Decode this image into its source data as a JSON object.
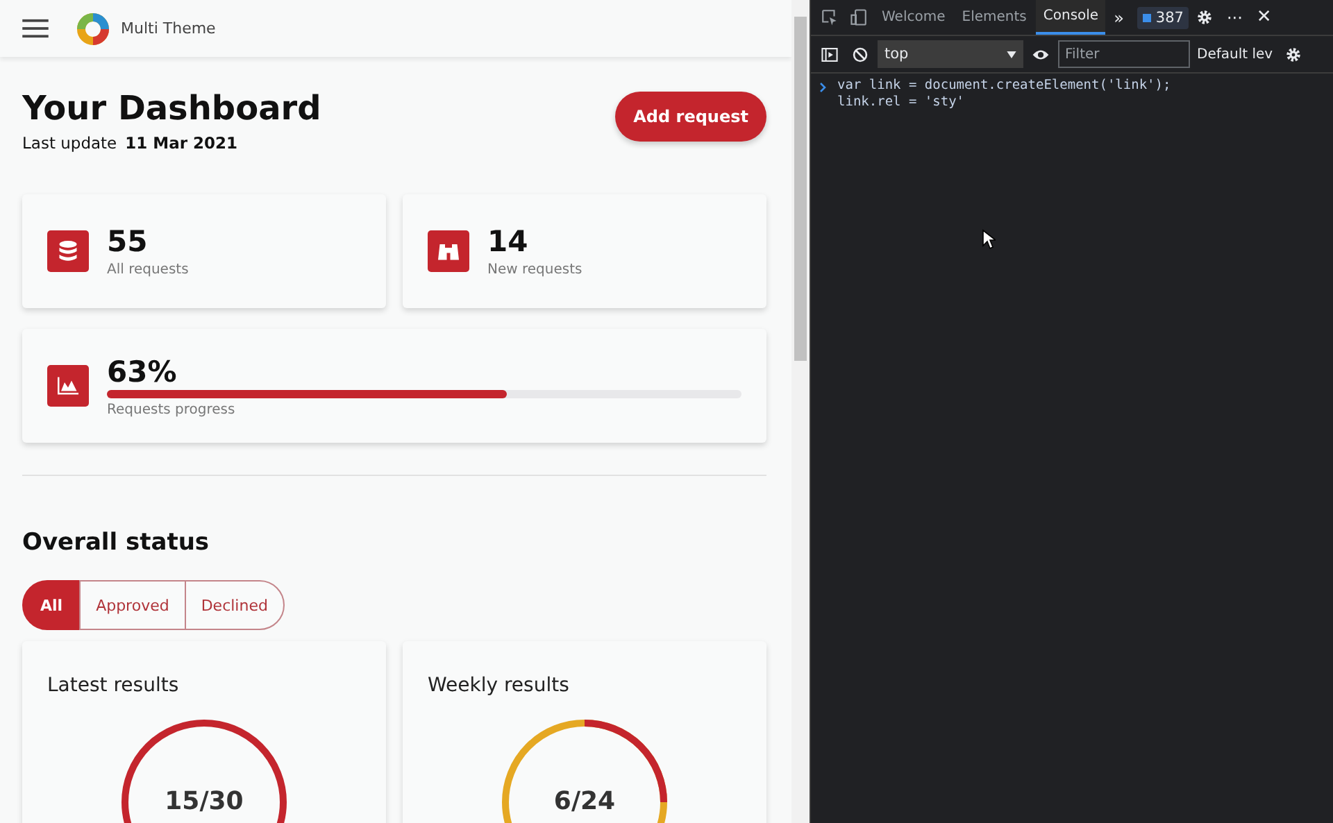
{
  "app": {
    "title": "Multi Theme"
  },
  "dashboard": {
    "title": "Your Dashboard",
    "update_label": "Last update",
    "update_date": "11 Mar 2021",
    "add_button": "Add request"
  },
  "stats": [
    {
      "kind": "total",
      "value": "55",
      "label": "All requests"
    },
    {
      "kind": "new",
      "value": "14",
      "label": "New requests"
    }
  ],
  "progress": {
    "value": "63%",
    "label": "Requests progress",
    "level": 0.63
  },
  "overall": {
    "title": "Overall status",
    "filters": [
      {
        "label": "All",
        "selected": true
      },
      {
        "label": "Approved",
        "selected": false
      },
      {
        "label": "Declined",
        "selected": false
      }
    ],
    "results": [
      {
        "title": "Latest results",
        "value": "15/30",
        "kind": "full"
      },
      {
        "title": "Weekly results",
        "value": "6/24",
        "kind": "split"
      }
    ]
  },
  "devtools": {
    "tabs": [
      {
        "label": "Welcome",
        "selected": false
      },
      {
        "label": "Elements",
        "selected": false
      },
      {
        "label": "Console",
        "selected": true
      }
    ],
    "more": "»",
    "badge": "387",
    "dots": "···",
    "close": "✕",
    "context": "top",
    "filter_placeholder": "Filter",
    "levels": "Default lev",
    "console_lines": [
      "var link = document.createElement('link');",
      "link.rel = 'sty'"
    ]
  }
}
